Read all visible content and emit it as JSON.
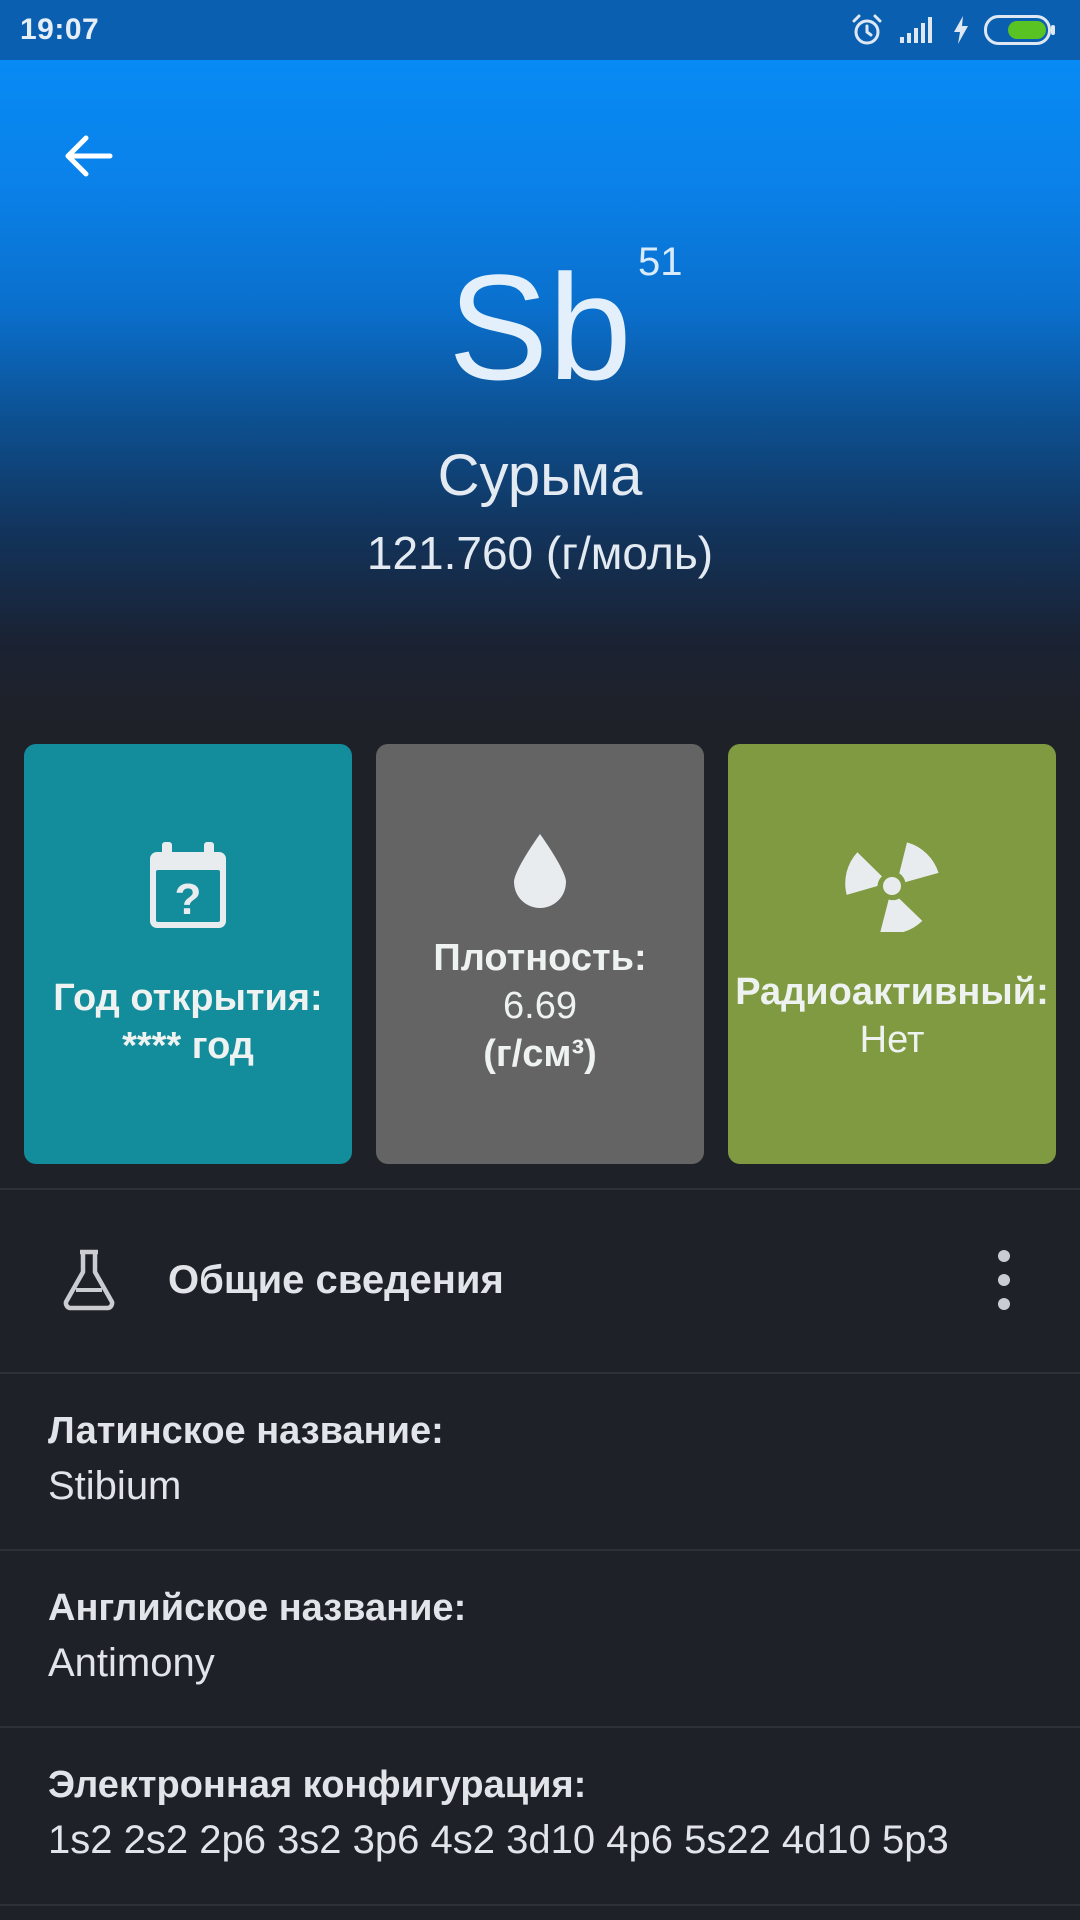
{
  "status_bar": {
    "time": "19:07",
    "icons": [
      "alarm-icon",
      "signal-icon",
      "charging-icon",
      "battery-icon"
    ],
    "battery_level": 1.0
  },
  "header": {
    "back_icon": "arrow-left-icon",
    "symbol": "Sb",
    "atomic_number": "51",
    "name": "Сурьма",
    "atomic_mass": "121.760 (г/моль)"
  },
  "cards": {
    "discovery": {
      "icon": "calendar-question-icon",
      "label": "Год открытия:",
      "value": "**** год",
      "color": "#138c9b"
    },
    "density": {
      "icon": "drop-icon",
      "label": "Плотность:",
      "value": "6.69",
      "unit": "(г/см³)",
      "color": "#646464"
    },
    "radioactive": {
      "icon": "radiation-icon",
      "label": "Радиоактивный:",
      "value": "Нет",
      "color": "#809a41"
    }
  },
  "section": {
    "icon": "flask-icon",
    "title": "Общие сведения",
    "menu_icon": "more-vertical-icon"
  },
  "info": [
    {
      "label": "Латинское название:",
      "value": "Stibium"
    },
    {
      "label": "Английское название:",
      "value": "Antimony"
    },
    {
      "label": "Электронная конфигурация:",
      "value": "1s2 2s2 2p6 3s2 3p6 4s2 3d10 4p6 5s22 4d10 5p3"
    }
  ],
  "colors": {
    "background": "#1f2128",
    "header_top": "#078af4",
    "status_bar": "#0b5fb1"
  }
}
